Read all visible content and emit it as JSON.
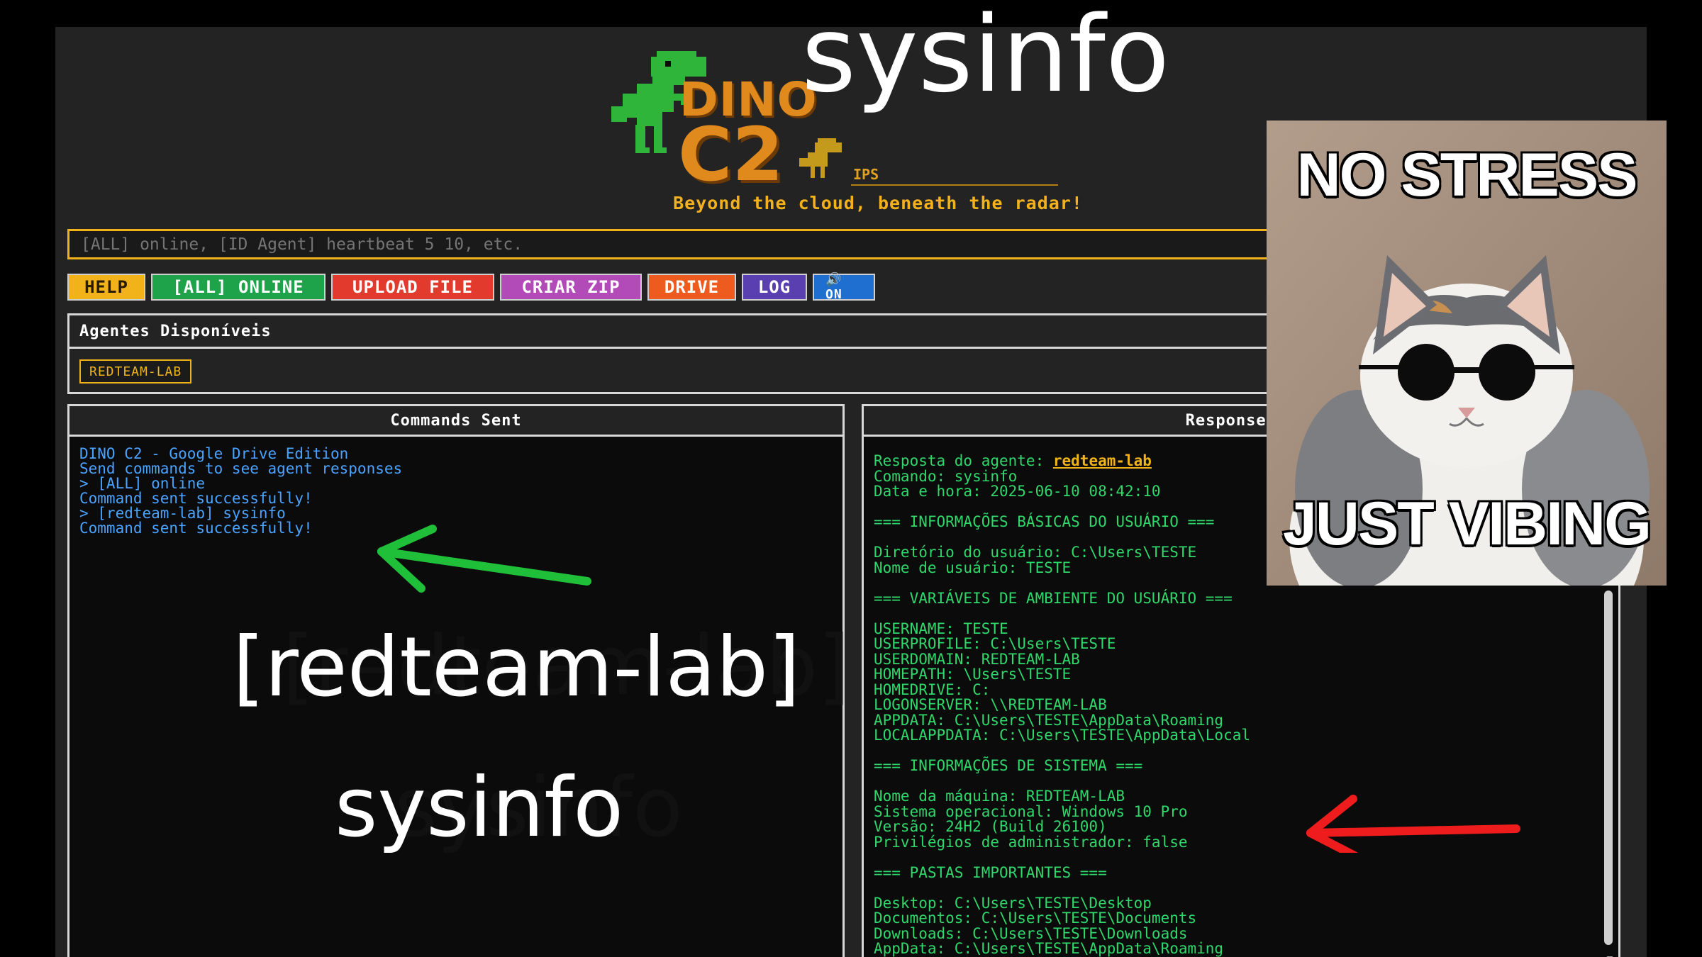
{
  "header": {
    "logo_word1": "DINO",
    "logo_word2": "C2",
    "ips": "IPS",
    "tagline": "Beyond the cloud, beneath the radar!"
  },
  "command_input": {
    "placeholder": "[ALL] online, [ID Agent] heartbeat 5 10, etc."
  },
  "buttons": {
    "help": "HELP",
    "all_online": "[ALL] ONLINE",
    "upload": "UPLOAD FILE",
    "zip": "CRIAR ZIP",
    "drive": "DRIVE",
    "log": "LOG",
    "sound": "🔊 ON"
  },
  "agents": {
    "title": "Agentes Disponíveis",
    "list": [
      "REDTEAM-LAB"
    ]
  },
  "commands_panel": {
    "title": "Commands Sent",
    "lines": [
      "DINO C2 - Google Drive Edition",
      "Send commands to see agent responses",
      "> [ALL] online",
      "Command sent successfully!",
      "> [redteam-lab] sysinfo",
      "Command sent successfully!"
    ]
  },
  "responses_panel": {
    "title": "Responses R",
    "agent_prefix": "Resposta do agente: ",
    "agent_name": "redteam-lab",
    "body": "Comando: sysinfo\nData e hora: 2025-06-10 08:42:10\n\n=== INFORMAÇÕES BÁSICAS DO USUÁRIO ===\n\nDiretório do usuário: C:\\Users\\TESTE\nNome de usuário: TESTE\n\n=== VARIÁVEIS DE AMBIENTE DO USUÁRIO ===\n\nUSERNAME: TESTE\nUSERPROFILE: C:\\Users\\TESTE\nUSERDOMAIN: REDTEAM-LAB\nHOMEPATH: \\Users\\TESTE\nHOMEDRIVE: C:\nLOGONSERVER: \\\\REDTEAM-LAB\nAPPDATA: C:\\Users\\TESTE\\AppData\\Roaming\nLOCALAPPDATA: C:\\Users\\TESTE\\AppData\\Local\n\n=== INFORMAÇÕES DE SISTEMA ===\n\nNome da máquina: REDTEAM-LAB\nSistema operacional: Windows 10 Pro\nVersão: 24H2 (Build 26100)\nPrivilégios de administrador: false\n\n=== PASTAS IMPORTANTES ===\n\nDesktop: C:\\Users\\TESTE\\Desktop\nDocumentos: C:\\Users\\TESTE\\Documents\nDownloads: C:\\Users\\TESTE\\Downloads\nAppData: C:\\Users\\TESTE\\AppData\\Roaming"
  },
  "overlay": {
    "title": "sysinfo",
    "caption_line1": "[redteam-lab]",
    "caption_line2": "sysinfo"
  },
  "meme": {
    "top_text": "NO STRESS",
    "bottom_text": "JUST VIBING"
  },
  "colors": {
    "accent": "#f0b31a",
    "command_text": "#4aa3ff",
    "response_text": "#2fd86a",
    "green_arrow": "#1fbf3a",
    "red_arrow": "#ee1c1c"
  }
}
